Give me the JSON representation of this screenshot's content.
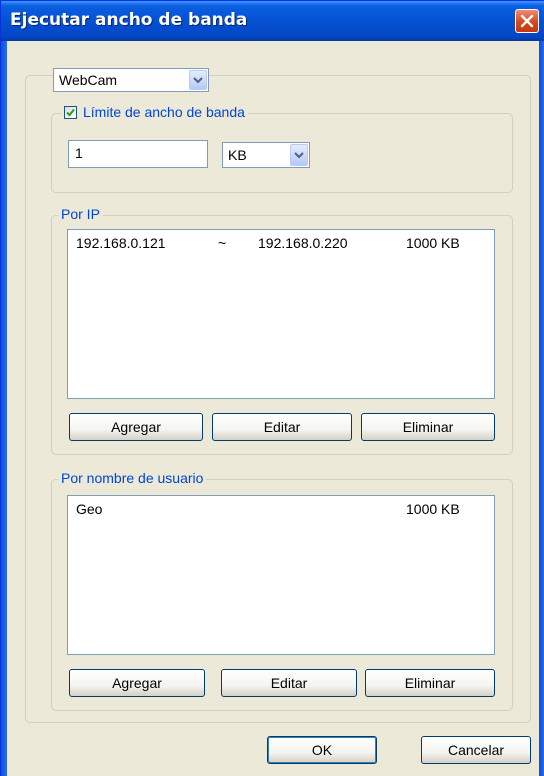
{
  "window": {
    "title": "Ejecutar ancho de banda"
  },
  "device_select": {
    "value": "WebCam"
  },
  "bandwidth_limit": {
    "label": "Límite de ancho de banda",
    "checked": true,
    "value": "1",
    "unit": "KB"
  },
  "by_ip": {
    "label": "Por IP",
    "rows": [
      {
        "start": "192.168.0.121",
        "sep": "~",
        "end": "192.168.0.220",
        "limit": "1000 KB"
      }
    ],
    "buttons": {
      "add": "Agregar",
      "edit": "Editar",
      "delete": "Eliminar"
    }
  },
  "by_user": {
    "label": "Por nombre de usuario",
    "rows": [
      {
        "name": "Geo",
        "limit": "1000 KB"
      }
    ],
    "buttons": {
      "add": "Agregar",
      "edit": "Editar",
      "delete": "Eliminar"
    }
  },
  "footer": {
    "ok": "OK",
    "cancel": "Cancelar"
  },
  "colors": {
    "titlebar": "#0551d4",
    "group_label": "#0046d5",
    "close": "#d8471c"
  }
}
